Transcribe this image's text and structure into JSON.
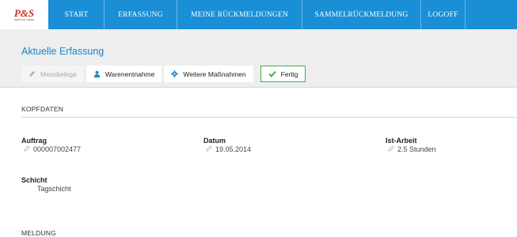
{
  "brand": {
    "logo": "P&S",
    "logo_sub": "SERVICE GMBH"
  },
  "nav": {
    "start": "START",
    "erfassung": "ERFASSUNG",
    "rueckmeldungen": "MEINE RÜCKMELDUNGEN",
    "sammel": "SAMMELRÜCKMELDUNG",
    "logoff": "LOGOFF"
  },
  "page": {
    "title": "Aktuelle Erfassung"
  },
  "actions": {
    "messbelege": "Messbelege",
    "warenentnahme": "Warenentnahme",
    "weitere": "Weitere Maßnahmen",
    "fertig": "Fertig"
  },
  "kopfdaten": {
    "heading": "KOPFDATEN",
    "auftrag": {
      "label": "Auftrag",
      "value": "000007002477"
    },
    "datum": {
      "label": "Datum",
      "value": "19.05.2014"
    },
    "ist_arbeit": {
      "label": "Ist-Arbeit",
      "value": "2.5 Stunden"
    },
    "schicht": {
      "label": "Schicht",
      "value": "Tagschicht"
    }
  },
  "meldung": {
    "heading": "MELDUNG"
  },
  "colors": {
    "accent": "#1a8fd6",
    "title": "#1a86c8",
    "success": "#3db043",
    "logo": "#d42a1e"
  },
  "icons": [
    "pencil-icon",
    "person-icon",
    "gear-icon",
    "check-icon"
  ]
}
